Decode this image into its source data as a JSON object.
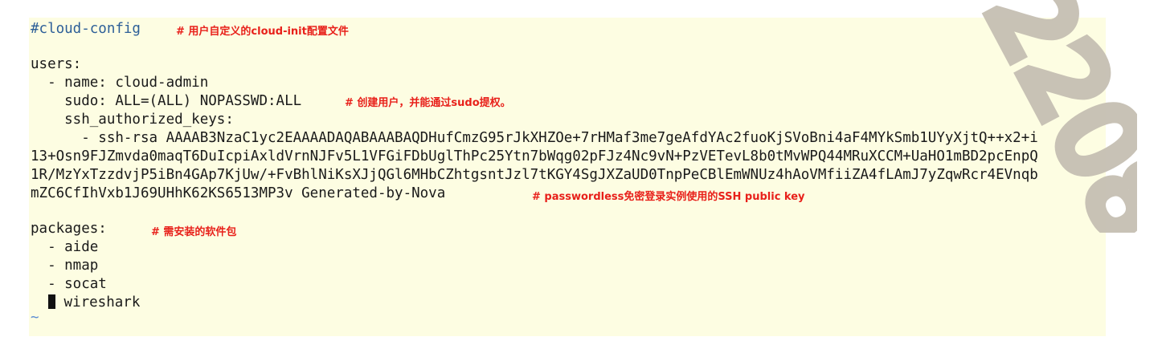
{
  "editor": {
    "lines": [
      {
        "code": "#cloud-config",
        "comment": "# 用户自定义的cloud-init配置文件"
      },
      {
        "code": "",
        "comment": ""
      },
      {
        "code": "users:",
        "comment": ""
      },
      {
        "code": "  - name: cloud-admin",
        "comment": ""
      },
      {
        "code": "    sudo: ALL=(ALL) NOPASSWD:ALL",
        "comment": "# 创建用户，并能通过sudo提权。"
      },
      {
        "code": "    ssh_authorized_keys:",
        "comment": ""
      },
      {
        "code": "      - ssh-rsa AAAAB3NzaC1yc2EAAAADAQABAAABAQDHufCmzG95rJkXHZOe+7rHMaf3me7geAfdYAc2fuoKjSVoBni4aF4MYkSmb1UYyXjtQ++x2+i",
        "comment": ""
      },
      {
        "code": "13+Osn9FJZmvda0maqT6DuIcpiAxldVrnNJFv5L1VFGiFDbUglThPc25Ytn7bWqg02pFJz4Nc9vN+PzVETevL8b0tMvWPQ44MRuXCCM+UaHO1mBD2pcEnpQ",
        "comment": ""
      },
      {
        "code": "1R/MzYxTzzdvjP5iBn4GAp7KjUw/+FvBhlNiKsXJjQGl6MHbCZhtgsntJzl7tKGY4SgJXZaUD0TnpPeCBlEmWNUz4hAoVMfiiZA4fLAmJ7yZqwRcr4EVnqb",
        "comment": ""
      },
      {
        "code": "mZC6CfIhVxb1J69UHhK62KS6513MP3v Generated-by-Nova",
        "comment": "# passwordless免密登录实例使用的SSH public key"
      },
      {
        "code": "",
        "comment": ""
      },
      {
        "code": "packages:",
        "comment": "# 需安装的软件包"
      },
      {
        "code": "  - aide",
        "comment": ""
      },
      {
        "code": "  - nmap",
        "comment": ""
      },
      {
        "code": "  - socat",
        "comment": ""
      },
      {
        "code": " wireshark",
        "comment": ""
      },
      {
        "code": "~",
        "comment": ""
      }
    ]
  },
  "watermark": {
    "text": "2208"
  },
  "colors": {
    "background": "#fdfde2",
    "comment": "#e8201a",
    "config_header": "#2d5f98",
    "tilde": "#5b8cd3",
    "watermark": "#c6bfb3"
  }
}
